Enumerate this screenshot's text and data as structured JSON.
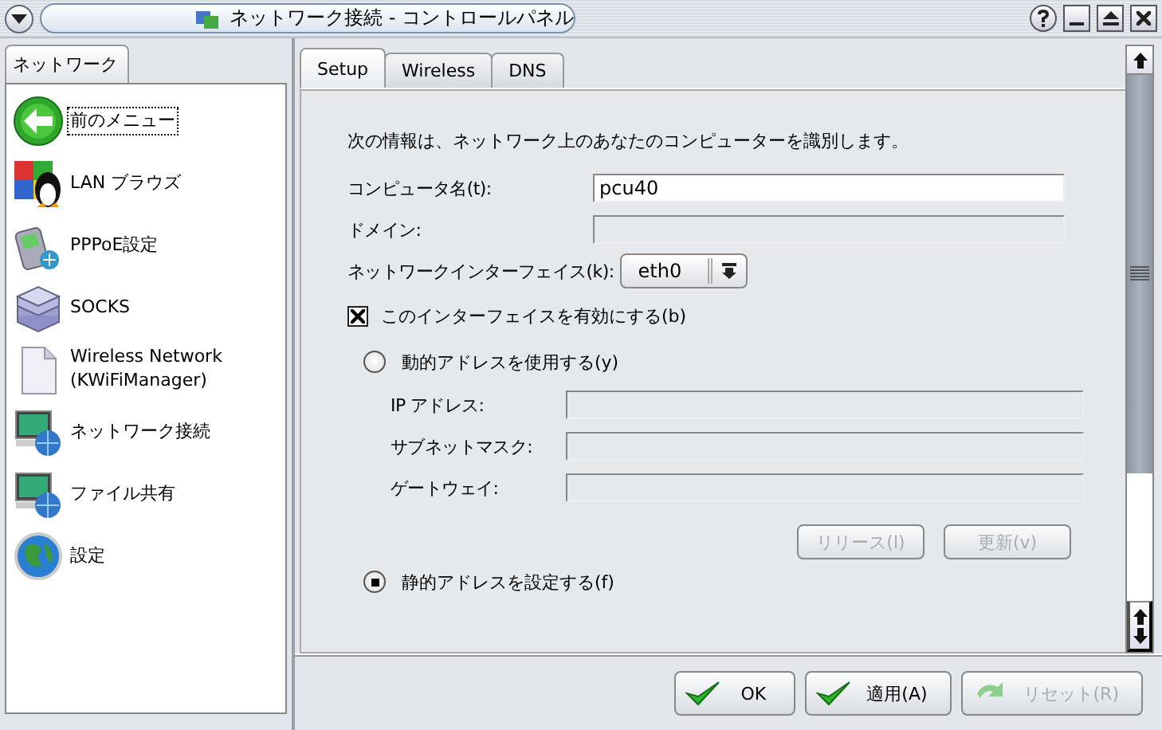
{
  "window": {
    "title": "ネットワーク接続 - コントロールパネル"
  },
  "sidebar": {
    "tab": "ネットワーク",
    "items": [
      {
        "label": "前のメニュー",
        "kind": "back",
        "selected": true
      },
      {
        "label": "LAN ブラウズ",
        "kind": "lan",
        "selected": false
      },
      {
        "label": "PPPoE設定",
        "kind": "phone",
        "selected": false
      },
      {
        "label": "SOCKS",
        "kind": "stack",
        "selected": false
      },
      {
        "label": "Wireless Network (KWiFiManager)",
        "kind": "document",
        "selected": false
      },
      {
        "label": "ネットワーク接続",
        "kind": "monitor",
        "selected": false
      },
      {
        "label": "ファイル共有",
        "kind": "monitor",
        "selected": false
      },
      {
        "label": "設定",
        "kind": "globe",
        "selected": false
      }
    ]
  },
  "tabs": [
    {
      "label": "Setup",
      "selected": true
    },
    {
      "label": "Wireless",
      "selected": false
    },
    {
      "label": "DNS",
      "selected": false
    }
  ],
  "form": {
    "intro": "次の情報は、ネットワーク上のあなたのコンピューターを識別します。",
    "fields": [
      {
        "label": "コンピュータ名(t):",
        "value": "pcu40",
        "disabled": false
      },
      {
        "label": "ドメイン:",
        "disabled": true
      }
    ],
    "interface": {
      "label": "ネットワークインターフェイス(k):",
      "value": "eth0"
    },
    "enable": {
      "label": "このインターフェイスを有効にする(b)",
      "checked": true
    },
    "modes": [
      {
        "label": "動的アドレスを使用する(y)",
        "selected": false,
        "fields": [
          {
            "label": "IP アドレス:",
            "disabled": true
          },
          {
            "label": "サブネットマスク:",
            "disabled": true
          },
          {
            "label": "ゲートウェイ:",
            "disabled": true
          }
        ],
        "buttons": [
          {
            "label": "リリース(l)",
            "disabled": true
          },
          {
            "label": "更新(v)",
            "disabled": true
          }
        ]
      },
      {
        "label": "静的アドレスを設定する(f)",
        "selected": true
      }
    ]
  },
  "buttons": [
    {
      "label": "OK",
      "kind": "ok",
      "disabled": false
    },
    {
      "label": "適用(A)",
      "kind": "ok",
      "disabled": false
    },
    {
      "label": "リセット(R)",
      "kind": "reset",
      "disabled": true
    }
  ]
}
